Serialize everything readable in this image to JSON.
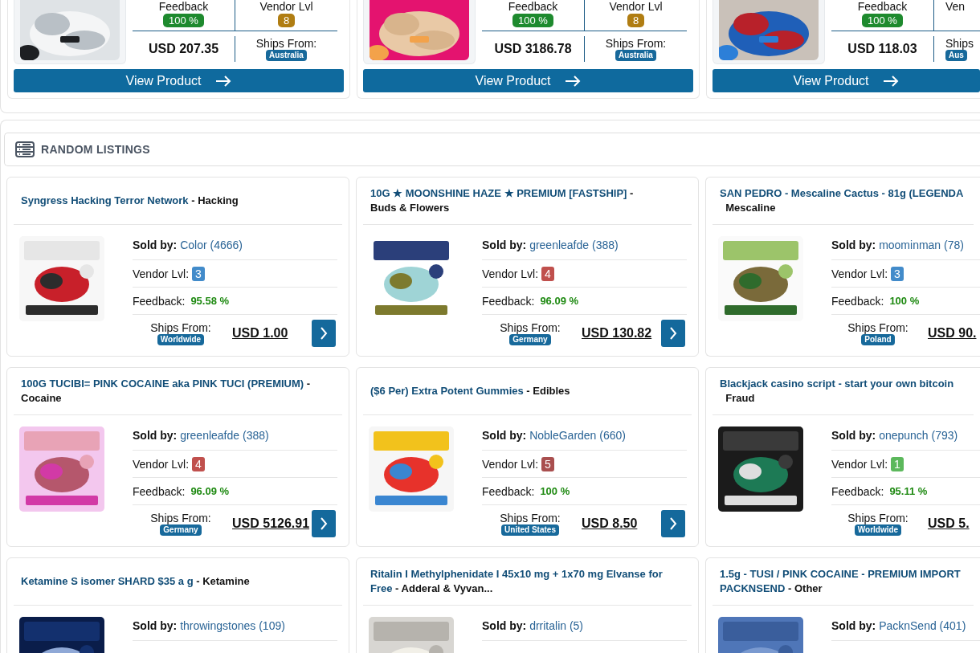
{
  "featured": [
    {
      "feedback_label": "Feedback",
      "feedback": "100 %",
      "vendor_label": "Vendor Lvl",
      "vendor_level": {
        "text": "8",
        "color": "#b07d12"
      },
      "price": "USD 207.35",
      "ships_label": "Ships From:",
      "ships_from": "Australia",
      "button": "View Product"
    },
    {
      "feedback_label": "Feedback",
      "feedback": "100 %",
      "vendor_label": "Vendor Lvl",
      "vendor_level": {
        "text": "8",
        "color": "#b07d12"
      },
      "price": "USD 3186.78",
      "ships_label": "Ships From:",
      "ships_from": "Australia",
      "button": "View Product"
    },
    {
      "feedback_label": "Feedback",
      "feedback": "100 %",
      "vendor_label": "Ven",
      "price": "USD 118.03",
      "ships_label": "Ships",
      "ships_from": "Aus",
      "button": "View Product"
    }
  ],
  "section_title": "RANDOM LISTINGS",
  "listings": [
    {
      "name": "Syngress Hacking Terror Network",
      "separator": "-",
      "category": "Hacking",
      "sold_label": "Sold by:",
      "vendor": "Color (4666)",
      "level_label": "Vendor Lvl:",
      "vendor_level": {
        "text": "3",
        "color": "#428bca"
      },
      "feedback_label": "Feedback:",
      "feedback": "95.58 %",
      "ships_label": "Ships From:",
      "ships_from": "Worldwide",
      "price": "USD 1.00"
    },
    {
      "name": "10G ★ MOONSHINE HAZE ★ PREMIUM [FASTSHIP]",
      "separator": "-",
      "category": "Buds & Flowers",
      "sold_label": "Sold by:",
      "vendor": "greenleafde (388)",
      "level_label": "Vendor Lvl:",
      "vendor_level": {
        "text": "4",
        "color": "#c0504d"
      },
      "feedback_label": "Feedback:",
      "feedback": "96.09 %",
      "ships_label": "Ships From:",
      "ships_from": "Germany",
      "price": "USD 130.82"
    },
    {
      "name": "SAN PEDRO - Mescaline Cactus - 81g (LEGENDA\n",
      "category": "Mescaline",
      "sold_label": "Sold by:",
      "vendor": "moominman (78)",
      "level_label": "Vendor Lvl:",
      "vendor_level": {
        "text": "3",
        "color": "#428bca"
      },
      "feedback_label": "Feedback:",
      "feedback": "100 %",
      "ships_label": "Ships From:",
      "ships_from": "Poland",
      "price": "USD 90."
    },
    {
      "name": "100G TUCIBI= PINK COCAINE aka PINK TUCI (PREMIUM)",
      "separator": "-",
      "category": "Cocaine",
      "sold_label": "Sold by:",
      "vendor": "greenleafde (388)",
      "level_label": "Vendor Lvl:",
      "vendor_level": {
        "text": "4",
        "color": "#c0504d"
      },
      "feedback_label": "Feedback:",
      "feedback": "96.09 %",
      "ships_label": "Ships From:",
      "ships_from": "Germany",
      "price": "USD 5126.91"
    },
    {
      "name": "($6 Per) Extra Potent Gummies",
      "separator": "-",
      "category": "Edibles",
      "sold_label": "Sold by:",
      "vendor": "NobleGarden (660)",
      "level_label": "Vendor Lvl:",
      "vendor_level": {
        "text": "5",
        "color": "#a94f4f"
      },
      "feedback_label": "Feedback:",
      "feedback": "100 %",
      "ships_label": "Ships From:",
      "ships_from": "United States",
      "price": "USD 8.50"
    },
    {
      "name": "Blackjack casino script - start your own bitcoin\n",
      "category": "Fraud",
      "sold_label": "Sold by:",
      "vendor": "onepunch (793)",
      "level_label": "Vendor Lvl:",
      "vendor_level": {
        "text": "1",
        "color": "#5cb85c"
      },
      "feedback_label": "Feedback:",
      "feedback": "95.11 %",
      "ships_label": "Ships From:",
      "ships_from": "Worldwide",
      "price": "USD 5."
    },
    {
      "name": "Ketamine S isomer SHARD $35 a g",
      "separator": "-",
      "category": "Ketamine",
      "sold_label": "Sold by:",
      "vendor": "throwingstones (109)"
    },
    {
      "name": "Ritalin I Methylphenidate I 45x10 mg + 1x70 mg Elvanse for Free",
      "separator": "-",
      "category": "Adderal & Vyvan...",
      "sold_label": "Sold by:",
      "vendor": "drritalin (5)"
    },
    {
      "name": "1.5g - TUSI / PINK COCAINE - PREMIUM IMPORT\nPACKNSEND",
      "separator": "-",
      "category": "Other",
      "sold_label": "Sold by:",
      "vendor": "PacknSend (401)"
    }
  ]
}
